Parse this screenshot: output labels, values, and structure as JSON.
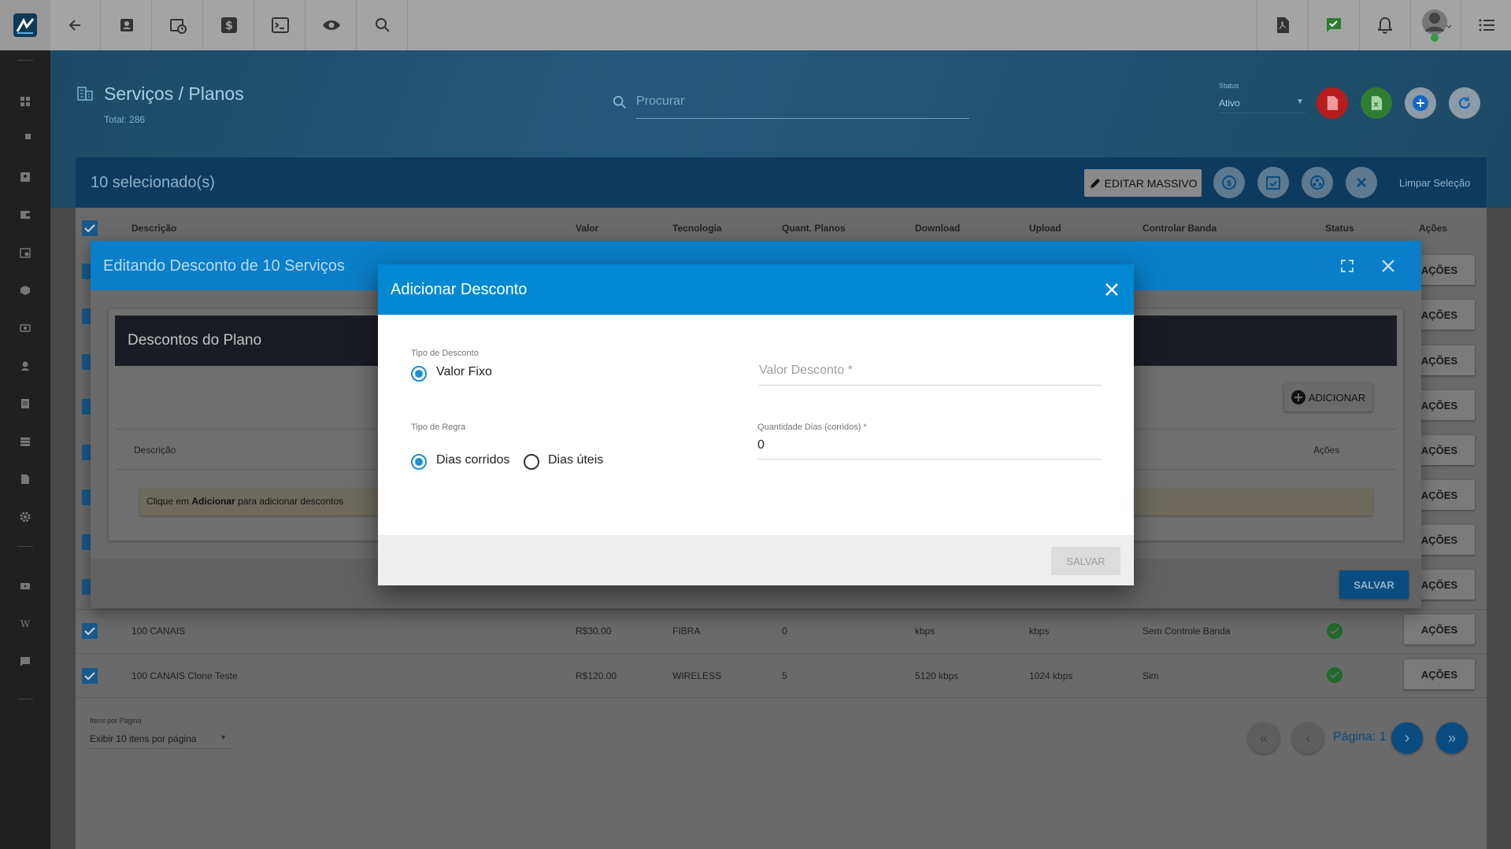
{
  "header": {
    "title": "Serviços / Planos",
    "total": "Total: 286",
    "search_placeholder": "Procurar",
    "status_label": "Status",
    "status_value": "Ativo"
  },
  "selection": {
    "count_text": "10 selecionado(s)",
    "edit_mass_label": "EDITAR MASSIVO",
    "clear_label": "Limpar Seleção"
  },
  "table": {
    "columns": [
      "Descrição",
      "Valor",
      "Tecnologia",
      "Quant. Planos",
      "Download",
      "Upload",
      "Controlar Banda",
      "Status",
      "Ações"
    ],
    "rows": [
      {
        "descricao": "100 CANAIS",
        "valor": "R$30.00",
        "tecnologia": "FIBRA",
        "quant": "0",
        "download": "kbps",
        "upload": "kbps",
        "controle": "Sem Controle Banda"
      },
      {
        "descricao": "100 CANAIS Clone Teste",
        "valor": "R$120.00",
        "tecnologia": "WIRELESS",
        "quant": "5",
        "download": "5120 kbps",
        "upload": "1024 kbps",
        "controle": "Sim"
      }
    ],
    "acoes_label": "AÇÕES"
  },
  "pagination": {
    "items_label": "Itens por Página",
    "items_value": "Exibir 10 itens por página",
    "page_text": "Página: 1"
  },
  "outer_modal": {
    "title": "Editando Desconto de 10 Serviços",
    "section_title": "Descontos do Plano",
    "add_label": "ADICIONAR",
    "col_descricao": "Descrição",
    "col_acoes": "Ações",
    "hint_prefix": "Clique em ",
    "hint_bold": "Adicionar",
    "hint_suffix": " para adicionar descontos",
    "save_label": "SALVAR"
  },
  "inner_modal": {
    "title": "Adicionar Desconto",
    "tipo_desconto_label": "Tipo de Desconto",
    "valor_fixo_label": "Valor Fixo",
    "valor_desconto_placeholder": "Valor Desconto *",
    "tipo_regra_label": "Tipo de Regra",
    "dias_corridos_label": "Dias corridos",
    "dias_uteis_label": "Dias úteis",
    "quantidade_dias_label": "Quantidade Dias (corridos) *",
    "quantidade_dias_value": "0",
    "save_label": "SALVAR"
  },
  "colors": {
    "primary": "#0188d3",
    "success": "#2e9e44",
    "danger": "#d32f2f"
  }
}
